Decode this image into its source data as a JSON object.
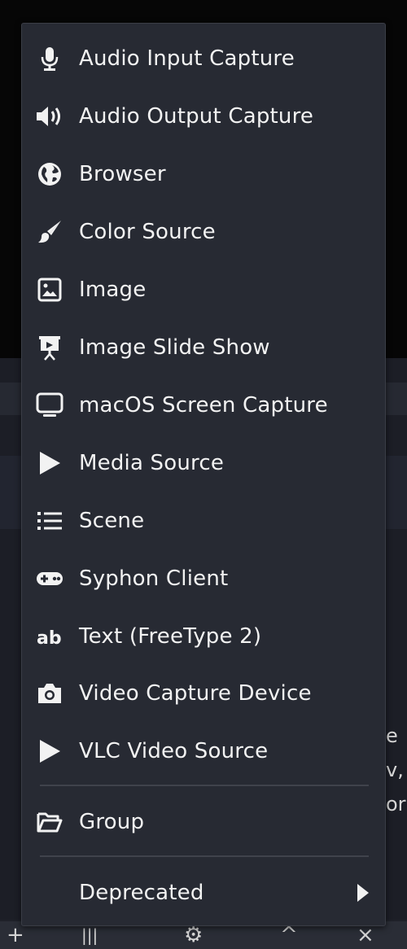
{
  "menu": {
    "items": [
      {
        "label": "Audio Input Capture",
        "icon": "microphone-icon"
      },
      {
        "label": "Audio Output Capture",
        "icon": "speaker-icon"
      },
      {
        "label": "Browser",
        "icon": "globe-icon"
      },
      {
        "label": "Color Source",
        "icon": "paintbrush-icon"
      },
      {
        "label": "Image",
        "icon": "image-icon"
      },
      {
        "label": "Image Slide Show",
        "icon": "slideshow-icon"
      },
      {
        "label": "macOS Screen Capture",
        "icon": "monitor-icon"
      },
      {
        "label": "Media Source",
        "icon": "play-icon"
      },
      {
        "label": "Scene",
        "icon": "list-icon"
      },
      {
        "label": "Syphon Client",
        "icon": "gamepad-icon"
      },
      {
        "label": "Text (FreeType 2)",
        "icon": "text-icon"
      },
      {
        "label": "Video Capture Device",
        "icon": "camera-icon"
      },
      {
        "label": "VLC Video Source",
        "icon": "play-icon"
      }
    ],
    "group": {
      "label": "Group",
      "icon": "folder-icon"
    },
    "deprecated": {
      "label": "Deprecated",
      "icon": "chevron-right-icon"
    }
  },
  "background_text": {
    "line1": "e",
    "line2": "v,",
    "line3": "or"
  },
  "colors": {
    "menu_bg": "#272a33",
    "text": "#f2f2f2",
    "separator": "#40434c"
  }
}
